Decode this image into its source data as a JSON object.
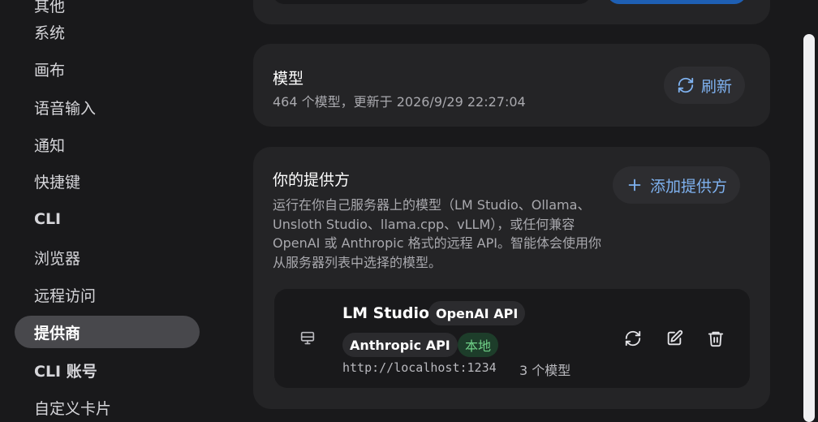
{
  "sidebar": {
    "items": [
      {
        "label": "其他"
      },
      {
        "label": "系统"
      },
      {
        "label": "画布"
      },
      {
        "label": "语音输入"
      },
      {
        "label": "通知"
      },
      {
        "label": "快捷键"
      },
      {
        "label": "CLI"
      },
      {
        "label": "浏览器"
      },
      {
        "label": "远程访问"
      },
      {
        "label": "提供商",
        "active": true
      },
      {
        "label": "CLI 账号"
      },
      {
        "label": "自定义卡片"
      }
    ]
  },
  "models_card": {
    "title": "模型",
    "subtitle": "464 个模型，更新于 2026/9/29 22:27:04",
    "refresh_label": "刷新"
  },
  "providers_card": {
    "title": "你的提供方",
    "add_label": "添加提供方",
    "description": "运行在你自己服务器上的模型（LM Studio、Ollama、Unsloth Studio、llama.cpp、vLLM），或任何兼容 OpenAI 或 Anthropic 格式的远程 API。智能体会使用你从服务器列表中选择的模型。",
    "provider": {
      "name": "LM Studio",
      "tags": [
        "OpenAI API",
        "Anthropic API"
      ],
      "local_tag": "本地",
      "url": "http://localhost:1234",
      "model_count": "3 个模型",
      "icons": [
        "server-icon",
        "refresh-icon",
        "edit-icon",
        "trash-icon"
      ]
    }
  },
  "colors": {
    "accent": "#7fb2f0",
    "primary_button": "#1e5fb3",
    "local_tag": "#6fcf87"
  }
}
